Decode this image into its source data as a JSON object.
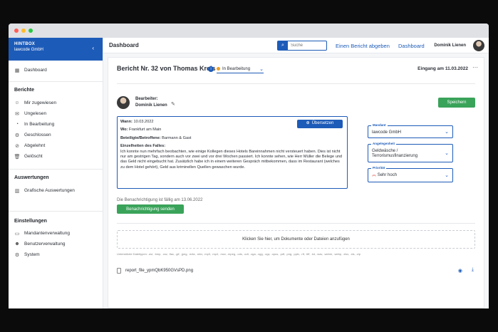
{
  "sidebar": {
    "brand_line1": "HINTBOX",
    "brand_line2": "lawcode GmbH",
    "dashboard": "Dashboard",
    "section_berichte": "Berichte",
    "berichte_items": [
      {
        "label": "Mir zugewiesen",
        "icon": "person-icon"
      },
      {
        "label": "Ungelesen",
        "icon": "mail-icon"
      },
      {
        "label": "In Bearbeitung",
        "icon": "progress-icon"
      },
      {
        "label": "Geschlossen",
        "icon": "gear-icon"
      },
      {
        "label": "Abgelehnt",
        "icon": "reject-icon"
      },
      {
        "label": "Gelöscht",
        "icon": "trash-icon"
      }
    ],
    "section_auswertungen": "Auswertungen",
    "grafische": "Grafische Auswertungen",
    "section_einstellungen": "Einstellungen",
    "einstellungen_items": [
      {
        "label": "Mandantenverwaltung",
        "icon": "folder-icon"
      },
      {
        "label": "Benutzerverwaltung",
        "icon": "users-icon"
      },
      {
        "label": "System",
        "icon": "gear-icon"
      }
    ]
  },
  "topbar": {
    "title": "Dashboard",
    "search_placeholder": "Suche",
    "link_bericht": "Einen Bericht abgeben",
    "link_dashboard": "Dashboard",
    "user_name": "Dominik Lienen"
  },
  "report": {
    "title": "Bericht Nr. 32 von Thomas Kreis",
    "status": "In Bearbeitung",
    "eingang": "Eingang am 11.03.2022",
    "editor_label": "Bearbeiter:",
    "editor_name": "Dominik Lienen",
    "save_label": "Speichern",
    "translate_label": "Übersetzen",
    "wann_label": "Wann:",
    "wann_value": "10.03.2022",
    "wo_label": "Wo:",
    "wo_value": "Frankfurt am Main",
    "beteiligte_label": "Beteiligte/Betroffene:",
    "beteiligte_value": "Barmann & Gast",
    "details_label": "Einzelheiten des Falles:",
    "details_text": "Ich konnte nun mehrfach beobachten, wie einige Kollegen dieses Hotels Bareinnahmen nicht versteuert haben. Dies ist nicht nur am gestrigen Tag, sondern auch vor zwei und vor drei Wochen passiert. Ich konnte sehen, wie Herr Müller die Belege und das Geld nicht eingebucht hat. Zusätzlich habe ich in einem weiteren Gespräch mitbekommen, dass im Restaurant (welches zu dem Hotel gehört), Geld aus kriminellen Quellen gewaschen wurde.",
    "due_text": "Die Benachrichtigung ist fällig am 13.06.2022",
    "send_label": "Benachrichtigung senden",
    "drop_text": "Klicken Sie hier, um Dokumente oder Dateien anzufügen",
    "types_text": "Unterstützte Dateitypen: .avi, .bmp, .csv, .flac, .gif, .jpeg, .m4a, .mkv, .mp3, .mp4, .mov, .mpeg, .ods, .odt, .oga, .ogg, .ogv, .opus, .pdf, .png, .pptx, .rtf, .tiff, .txt, .wav, .webm, .webp, .xlsx, .xls, .zip",
    "file_name": "report_file_ypmQbK950GVsPD.png"
  },
  "fields": {
    "mandant_label": "Mandant",
    "mandant_value": "lawcode GmbH",
    "angelegenheit_label": "Angelegenheit",
    "angelegenheit_value": "Geldwäsche / Terrorismusfinanzierung",
    "prioritaet_label": "Priorität",
    "prioritaet_value": "Sehr hoch"
  },
  "colors": {
    "accent": "#1d5bb8",
    "success": "#3aa35a",
    "status_orange": "#f0a020",
    "priority_red": "#d9443a"
  }
}
